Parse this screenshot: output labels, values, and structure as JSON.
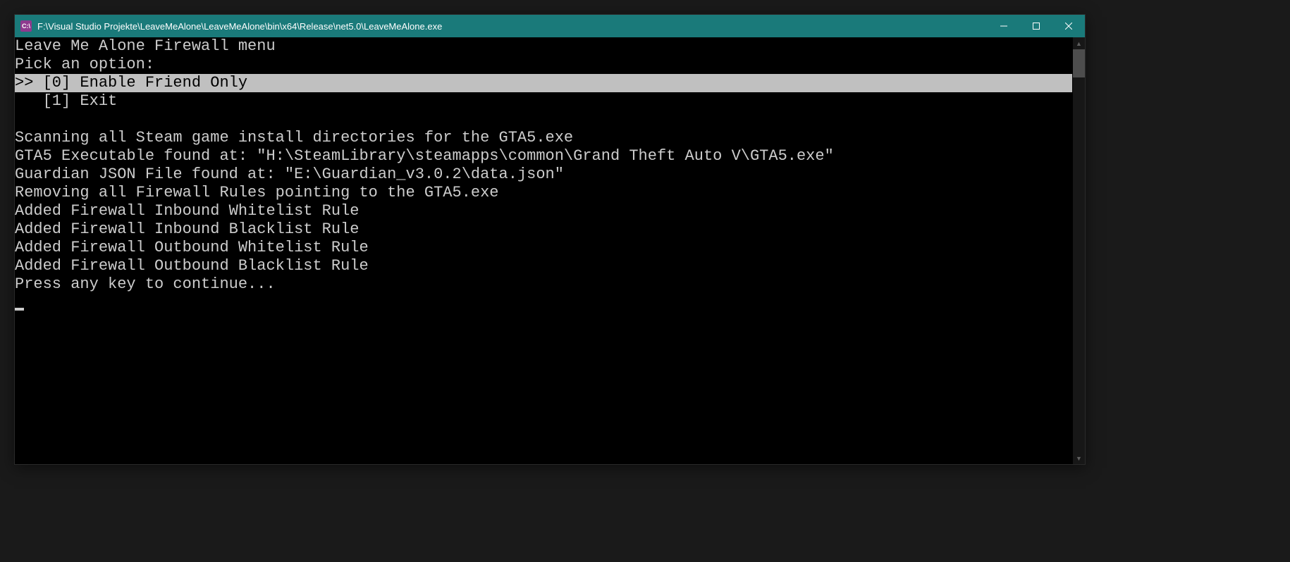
{
  "titlebar": {
    "icon_text": "C:\\",
    "title": "F:\\Visual Studio Projekte\\LeaveMeAlone\\LeaveMeAlone\\bin\\x64\\Release\\net5.0\\LeaveMeAlone.exe"
  },
  "console": {
    "lines": [
      {
        "text": "Leave Me Alone Firewall menu",
        "selected": false
      },
      {
        "text": "Pick an option:",
        "selected": false
      },
      {
        "text": ">> [0] Enable Friend Only",
        "selected": true
      },
      {
        "text": "   [1] Exit",
        "selected": false
      },
      {
        "text": "",
        "selected": false
      },
      {
        "text": "Scanning all Steam game install directories for the GTA5.exe",
        "selected": false
      },
      {
        "text": "GTA5 Executable found at: \"H:\\SteamLibrary\\steamapps\\common\\Grand Theft Auto V\\GTA5.exe\"",
        "selected": false
      },
      {
        "text": "Guardian JSON File found at: \"E:\\Guardian_v3.0.2\\data.json\"",
        "selected": false
      },
      {
        "text": "Removing all Firewall Rules pointing to the GTA5.exe",
        "selected": false
      },
      {
        "text": "Added Firewall Inbound Whitelist Rule",
        "selected": false
      },
      {
        "text": "Added Firewall Inbound Blacklist Rule",
        "selected": false
      },
      {
        "text": "Added Firewall Outbound Whitelist Rule",
        "selected": false
      },
      {
        "text": "Added Firewall Outbound Blacklist Rule",
        "selected": false
      },
      {
        "text": "Press any key to continue...",
        "selected": false
      }
    ]
  }
}
